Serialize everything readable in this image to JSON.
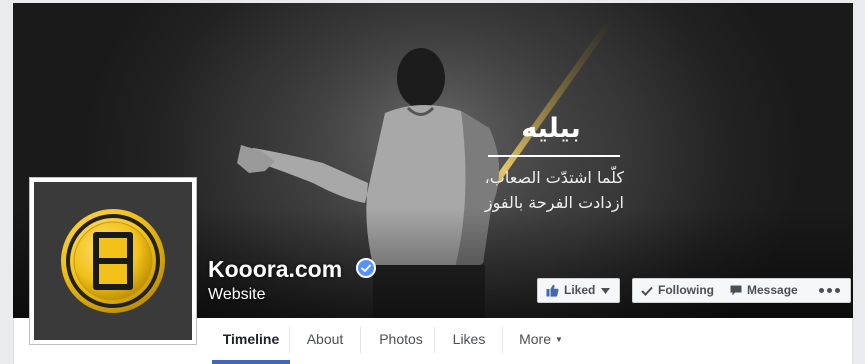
{
  "cover": {
    "title": "بيليه",
    "line1": "كلّما اشتدّت الصعاب،",
    "line2": "ازدادت الفرحة بالفوز"
  },
  "page": {
    "name": "Kooora.com",
    "category": "Website",
    "verified": true
  },
  "actions": {
    "liked_label": "Liked",
    "following_label": "Following",
    "message_label": "Message"
  },
  "tabs": [
    {
      "label": "Timeline",
      "active": true
    },
    {
      "label": "About"
    },
    {
      "label": "Photos"
    },
    {
      "label": "Likes"
    },
    {
      "label": "More"
    }
  ],
  "colors": {
    "accent": "#4267b2",
    "verified_badge": "#5890ff",
    "logo_gold": "#f5c518"
  },
  "icons": [
    "like-thumb-icon",
    "chevron-down-icon",
    "checkmark-icon",
    "message-icon",
    "more-dots-icon",
    "verified-badge-icon",
    "kooora-logo-icon"
  ]
}
